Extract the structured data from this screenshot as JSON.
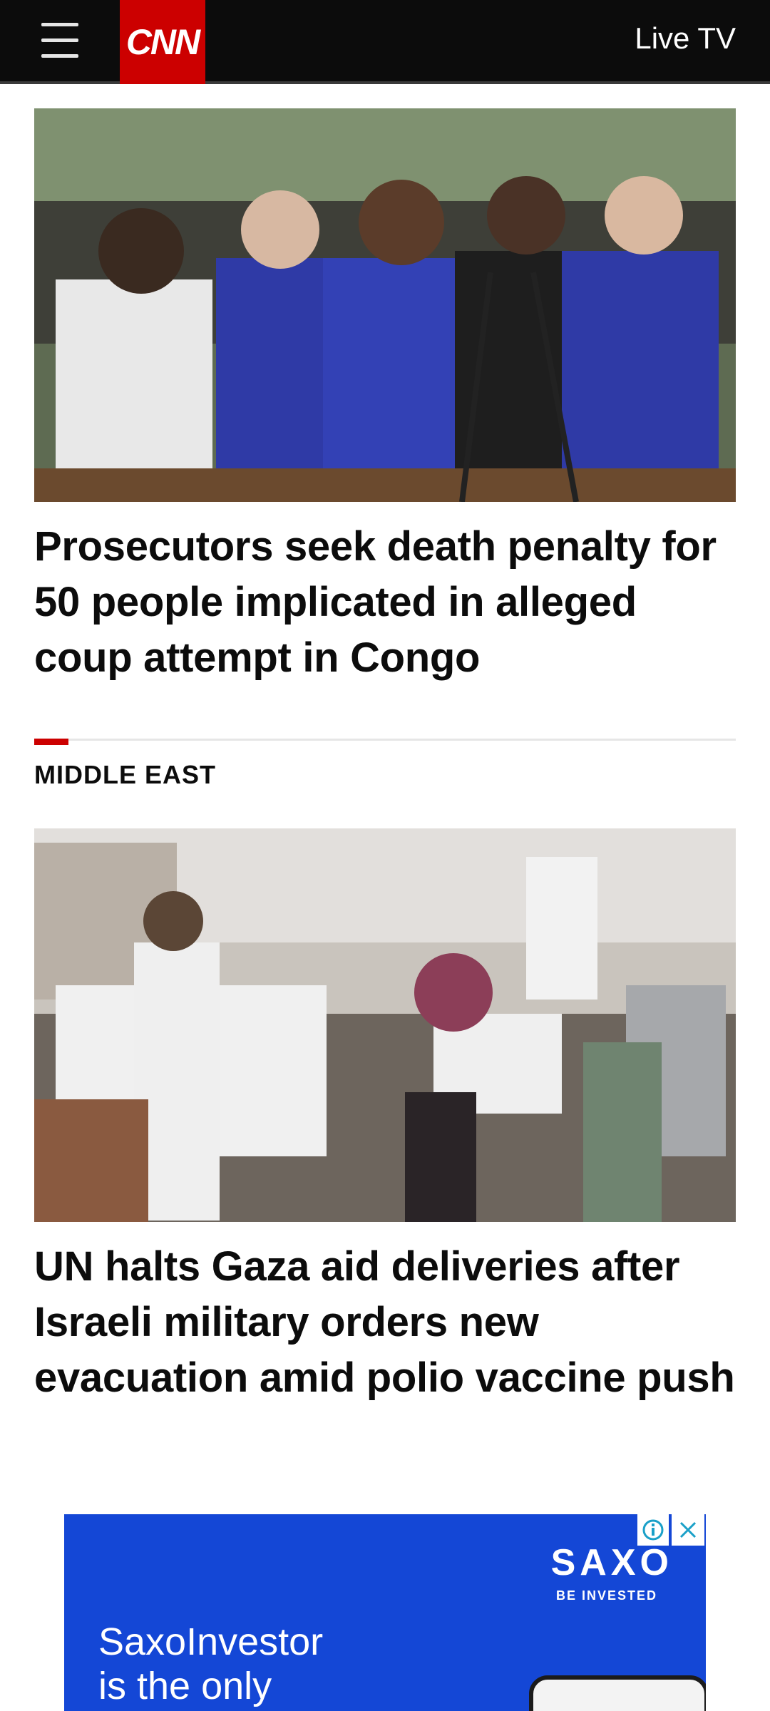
{
  "header": {
    "logo_text": "CNN",
    "live_tv_label": "Live TV"
  },
  "stories": [
    {
      "headline": "Prosecutors seek death penalty for 50 people implicated in alleged coup attempt in Congo",
      "image_alt": "Defendants in blue and yellow uniforms stand before microphones at a court hearing"
    },
    {
      "section": "MIDDLE EAST",
      "headline": "UN halts Gaza aid deliveries after Israeli military orders new evacuation amid polio vaccine push",
      "image_alt": "Crowded street of displaced people with vehicles and belongings"
    }
  ],
  "ad": {
    "brand": "SAXO",
    "tagline": "BE INVESTED",
    "copy_line1": "SaxoInvestor",
    "copy_line2": "is the only"
  },
  "colors": {
    "brand_red": "#cc0000",
    "header_bg": "#0c0c0c",
    "ad_blue": "#1447d6"
  }
}
